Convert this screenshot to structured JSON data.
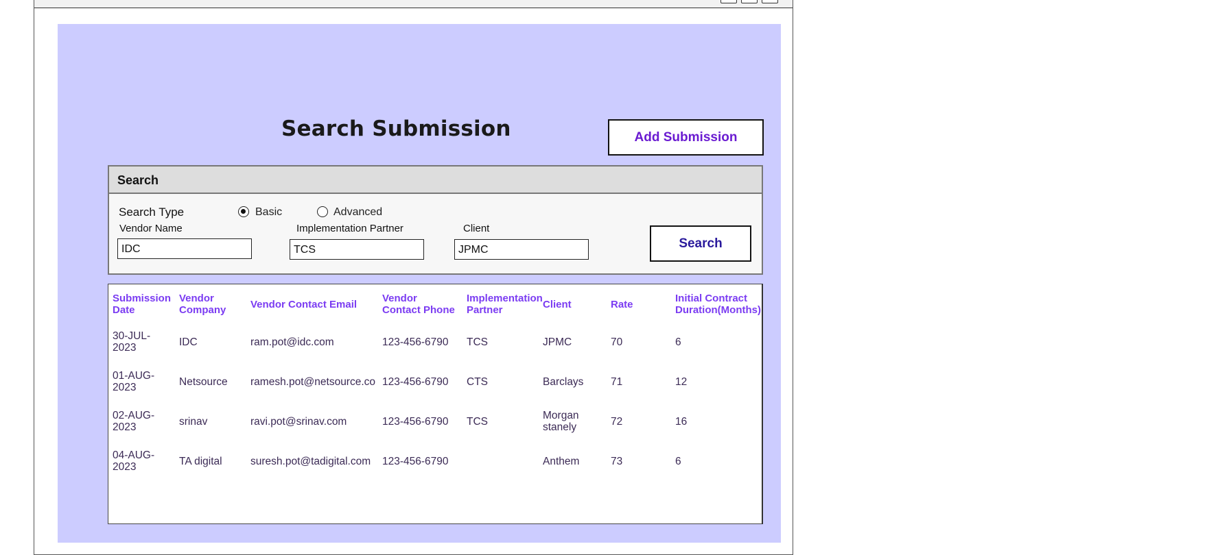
{
  "page": {
    "title": "Search Submission",
    "add_button_label": "Add Submission"
  },
  "search_panel": {
    "header": "Search",
    "search_type_label": "Search Type",
    "options": [
      {
        "label": "Basic",
        "selected": true
      },
      {
        "label": "Advanced",
        "selected": false
      }
    ],
    "fields": {
      "vendor_name": {
        "label": "Vendor Name",
        "value": "IDC"
      },
      "implementation_partner": {
        "label": "Implementation Partner",
        "value": "TCS"
      },
      "client": {
        "label": "Client",
        "value": "JPMC"
      }
    },
    "search_button_label": "Search"
  },
  "table": {
    "columns": [
      [
        "Submission",
        "Date"
      ],
      [
        "Vendor",
        "Company"
      ],
      [
        "Vendor Contact Email"
      ],
      [
        "Vendor",
        "Contact Phone"
      ],
      [
        "Implementation",
        "Partner"
      ],
      [
        "Client"
      ],
      [
        "Rate"
      ],
      [
        "Initial Contract",
        "Duration(Months)"
      ]
    ],
    "rows": [
      {
        "date": [
          "30-JUL-",
          "2023"
        ],
        "company": "IDC",
        "email": "ram.pot@idc.com",
        "phone": "123-456-6790",
        "partner": "TCS",
        "client": [
          "JPMC"
        ],
        "rate": "70",
        "duration": "6"
      },
      {
        "date": [
          "01-AUG-",
          "2023"
        ],
        "company": "Netsource",
        "email": "ramesh.pot@netsource.co",
        "phone": "123-456-6790",
        "partner": "CTS",
        "client": [
          "Barclays"
        ],
        "rate": "71",
        "duration": "12"
      },
      {
        "date": [
          "02-AUG-",
          "2023"
        ],
        "company": "srinav",
        "email": "ravi.pot@srinav.com",
        "phone": "123-456-6790",
        "partner": "TCS",
        "client": [
          "Morgan",
          "stanely"
        ],
        "rate": "72",
        "duration": "16"
      },
      {
        "date": [
          "04-AUG-",
          "2023"
        ],
        "company": "TA digital",
        "email": "suresh.pot@tadigital.com",
        "phone": "123-456-6790",
        "partner": "",
        "client": [
          "Anthem"
        ],
        "rate": "73",
        "duration": "6"
      }
    ]
  },
  "colors": {
    "background": "#ccccff",
    "header_text": "#7b3cf2",
    "cell_text": "#3b2a55",
    "add_button_text": "#6a1bd1",
    "search_button_text": "#2a1a9c"
  }
}
